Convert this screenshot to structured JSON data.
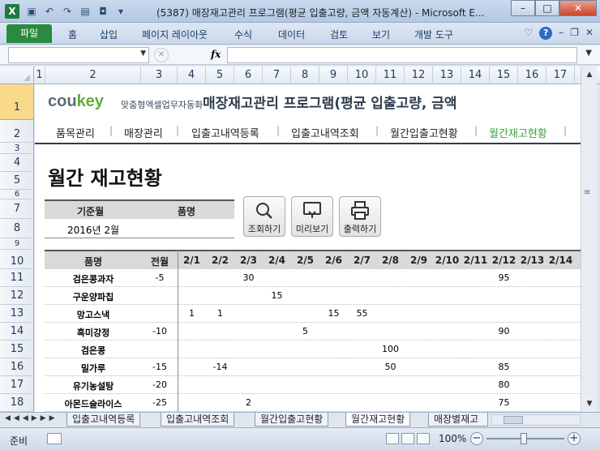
{
  "window": {
    "title": "(5387) 매장재고관리 프로그램(평균 입출고량, 금액 자동계산) - Microsoft E...",
    "app_icon": "X",
    "minimize": "–",
    "maximize": "□",
    "close": "✕"
  },
  "ribbon": {
    "file_tab": "파일",
    "tabs": [
      "홈",
      "삽입",
      "페이지 레이아웃",
      "수식",
      "데이터",
      "검토",
      "보기",
      "개발 도구"
    ]
  },
  "formula_bar": {
    "fx_label": "fx"
  },
  "columns": [
    "1",
    "2",
    "3",
    "4",
    "5",
    "6",
    "7",
    "8",
    "9",
    "10",
    "11",
    "12",
    "13",
    "14",
    "15",
    "16",
    "17"
  ],
  "rows": [
    "1",
    "2",
    "3",
    "4",
    "5",
    "6",
    "7",
    "8",
    "9",
    "10",
    "11",
    "12",
    "13",
    "14",
    "15",
    "16",
    "17",
    "18"
  ],
  "brand": {
    "logo_main": "cou",
    "logo_accent": "key",
    "logo_sub": "맞춤형엑셀업무자동화",
    "app_title": "매장재고관리 프로그램(평균 입출고량, 금액"
  },
  "nav": {
    "items": [
      "품목관리",
      "매장관리",
      "입출고내역등록",
      "입출고내역조회",
      "월간입출고현황",
      "월간재고현황"
    ],
    "active_index": 5,
    "separator": "|"
  },
  "page_title": "월간 재고현황",
  "filter": {
    "month_label": "기준월",
    "item_label": "품명",
    "month_value": "2016년 2월",
    "item_value": ""
  },
  "buttons": {
    "search": "조회하기",
    "preview": "미리보기",
    "print": "출력하기"
  },
  "table": {
    "headers": [
      "품명",
      "전월",
      "2/1",
      "2/2",
      "2/3",
      "2/4",
      "2/5",
      "2/6",
      "2/7",
      "2/8",
      "2/9",
      "2/10",
      "2/11",
      "2/12",
      "2/13",
      "2/14"
    ],
    "rows": [
      {
        "name": "검은콩과자",
        "prev": "-5",
        "cells": [
          "",
          "",
          "30",
          "",
          "",
          "",
          "",
          "",
          "",
          "",
          "",
          "95",
          "",
          ""
        ]
      },
      {
        "name": "구운양파칩",
        "prev": "",
        "cells": [
          "",
          "",
          "",
          "15",
          "",
          "",
          "",
          "",
          "",
          "",
          "",
          "",
          "",
          ""
        ]
      },
      {
        "name": "망고스낵",
        "prev": "",
        "cells": [
          "1",
          "1",
          "",
          "",
          "",
          "15",
          "55",
          "",
          "",
          "",
          "",
          "",
          "",
          ""
        ]
      },
      {
        "name": "흑미강정",
        "prev": "-10",
        "cells": [
          "",
          "",
          "",
          "",
          "5",
          "",
          "",
          "",
          "",
          "",
          "",
          "90",
          "",
          ""
        ]
      },
      {
        "name": "검은콩",
        "prev": "",
        "cells": [
          "",
          "",
          "",
          "",
          "",
          "",
          "",
          "100",
          "",
          "",
          "",
          "",
          "",
          ""
        ]
      },
      {
        "name": "밀가루",
        "prev": "-15",
        "cells": [
          "",
          "-14",
          "",
          "",
          "",
          "",
          "",
          "50",
          "",
          "",
          "",
          "85",
          "",
          ""
        ]
      },
      {
        "name": "유기농설탕",
        "prev": "-20",
        "cells": [
          "",
          "",
          "",
          "",
          "",
          "",
          "",
          "",
          "",
          "",
          "",
          "80",
          "",
          ""
        ]
      },
      {
        "name": "아몬드슬라이스",
        "prev": "-25",
        "cells": [
          "",
          "",
          "2",
          "",
          "",
          "",
          "",
          "",
          "",
          "",
          "",
          "75",
          "",
          ""
        ]
      }
    ]
  },
  "sheet_tabs": [
    "입출고내역등록",
    "입출고내역조회",
    "월간입출고현황",
    "월간재고현황",
    "매장별재고"
  ],
  "active_sheet": 3,
  "status": {
    "ready": "준비",
    "zoom": "100%"
  }
}
